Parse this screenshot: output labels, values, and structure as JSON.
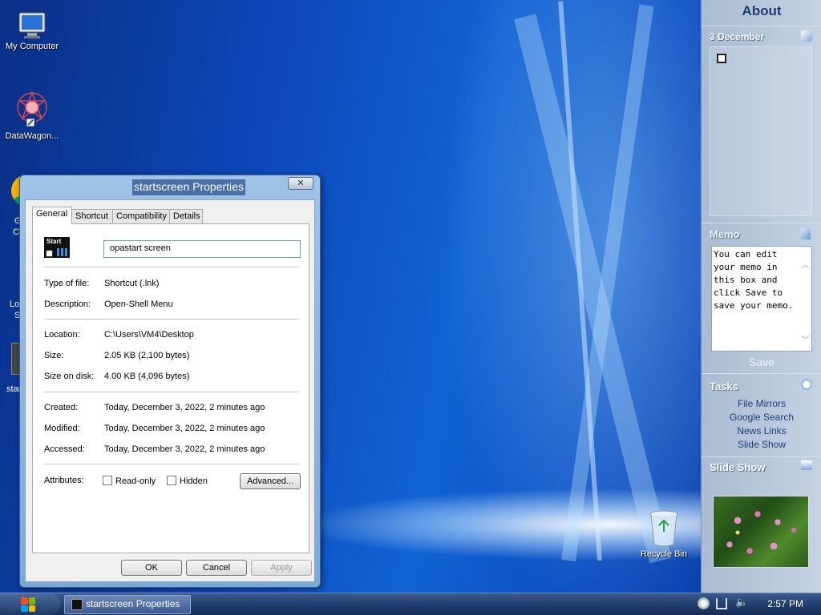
{
  "desktop": {
    "icons": [
      {
        "label": "My Computer",
        "icon": "monitor-icon"
      },
      {
        "label": "DataWagon...",
        "icon": "datawagon-icon"
      },
      {
        "label": "Recycle Bin",
        "icon": "recycle-bin-icon"
      }
    ],
    "partial_labels": [
      "G",
      "Ch",
      "Lo",
      "Sl",
      "star"
    ]
  },
  "dialog": {
    "title": "startscreen Properties",
    "close_label": "✕",
    "tabs": [
      "General",
      "Shortcut",
      "Compatibility",
      "Details"
    ],
    "active_tab": "General",
    "file_icon_label": "Start",
    "name_value": "opastart screen",
    "fields": {
      "type_label": "Type of file:",
      "type_value": "Shortcut (.lnk)",
      "desc_label": "Description:",
      "desc_value": "Open-Shell Menu",
      "location_label": "Location:",
      "location_value": "C:\\Users\\VM4\\Desktop",
      "size_label": "Size:",
      "size_value": "2.05 KB (2,100 bytes)",
      "sizedisk_label": "Size on disk:",
      "sizedisk_value": "4.00 KB (4,096 bytes)",
      "created_label": "Created:",
      "created_value": "Today, December 3, 2022, 2 minutes ago",
      "modified_label": "Modified:",
      "modified_value": "Today, December 3, 2022, 2 minutes ago",
      "accessed_label": "Accessed:",
      "accessed_value": "Today, December 3, 2022, 2 minutes ago",
      "attributes_label": "Attributes:"
    },
    "attributes": {
      "readonly_label": "Read-only",
      "readonly_checked": false,
      "hidden_label": "Hidden",
      "hidden_checked": false
    },
    "advanced_label": "Advanced...",
    "ok_label": "OK",
    "cancel_label": "Cancel",
    "apply_label": "Apply"
  },
  "sidebar": {
    "header": "About",
    "calendar_title": "3 December",
    "memo_title": "Memo",
    "memo_text": "You can edit your memo in this box and click Save to save your memo.",
    "memo_save": "Save",
    "tasks_title": "Tasks",
    "tasks": [
      "File Mirrors",
      "Google Search",
      "News Links",
      "Slide Show"
    ],
    "slideshow_title": "Slide Show"
  },
  "taskbar": {
    "task_label": "startscreen Properties",
    "clock": "2:57 PM"
  },
  "colors": {
    "accent": "#4a6fa6",
    "desktop": "#0d47b8",
    "sidebar": "#b8c8dc"
  }
}
